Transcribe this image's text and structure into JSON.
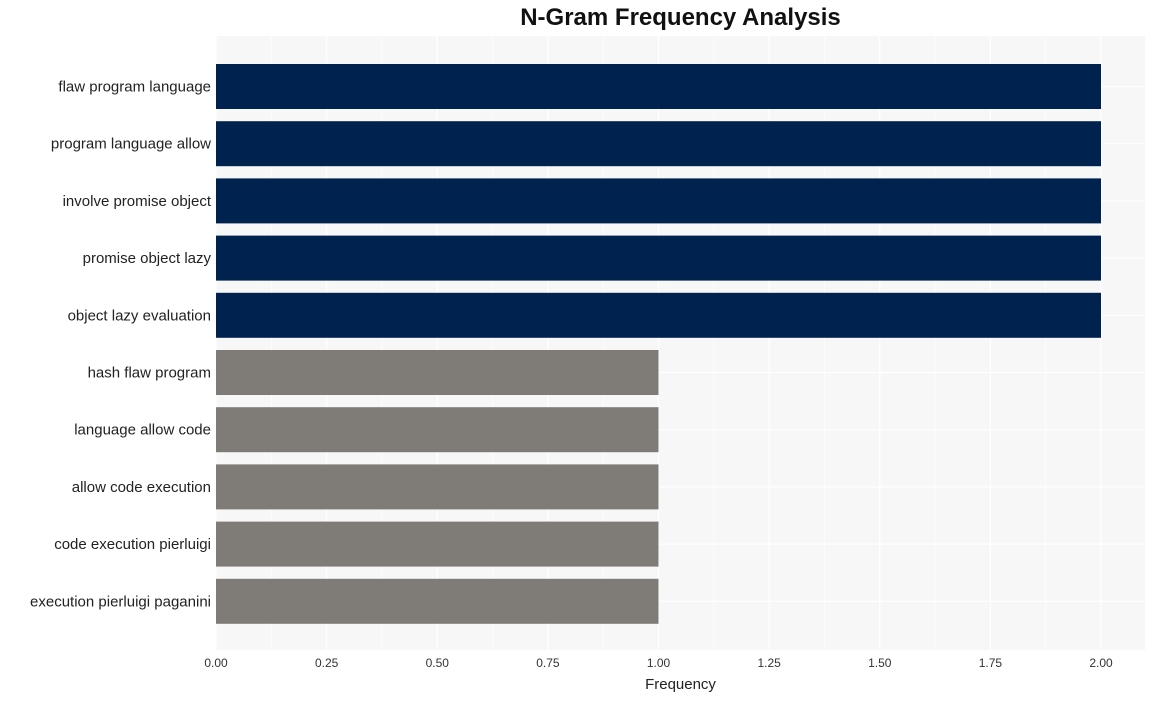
{
  "chart_data": {
    "type": "bar",
    "orientation": "horizontal",
    "title": "N-Gram Frequency Analysis",
    "xlabel": "Frequency",
    "ylabel": "",
    "xlim": [
      0,
      2.1
    ],
    "xticks": [
      "0.00",
      "0.25",
      "0.50",
      "0.75",
      "1.00",
      "1.25",
      "1.50",
      "1.75",
      "2.00"
    ],
    "grid": true,
    "categories": [
      "flaw program language",
      "program language allow",
      "involve promise object",
      "promise object lazy",
      "object lazy evaluation",
      "hash flaw program",
      "language allow code",
      "allow code execution",
      "code execution pierluigi",
      "execution pierluigi paganini"
    ],
    "values": [
      2,
      2,
      2,
      2,
      2,
      1,
      1,
      1,
      1,
      1
    ],
    "colors": {
      "high": "#00224e",
      "low": "#7f7c78",
      "panel": "#f7f7f7",
      "grid": "#ffffff"
    }
  }
}
